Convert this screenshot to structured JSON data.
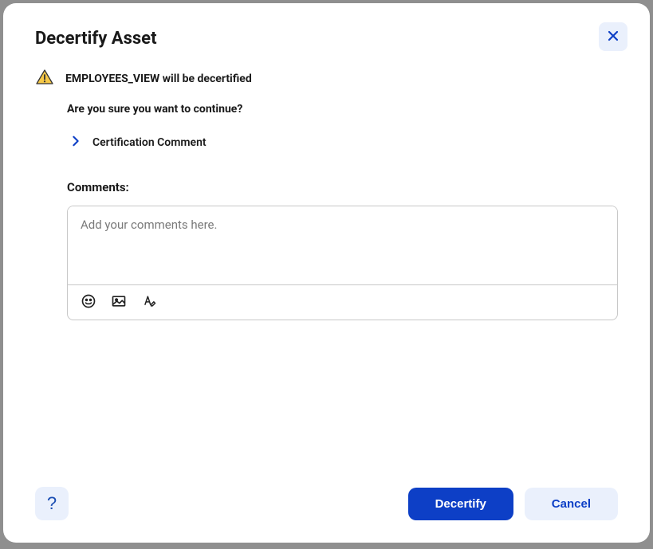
{
  "modal": {
    "title": "Decertify Asset",
    "warning_message": "EMPLOYEES_VIEW will be decertified",
    "confirm_question": "Are you sure you want to continue?",
    "expand_section_label": "Certification Comment",
    "comments_label": "Comments:",
    "comments_placeholder": "Add your comments here.",
    "help_label": "?",
    "primary_button": "Decertify",
    "secondary_button": "Cancel"
  }
}
